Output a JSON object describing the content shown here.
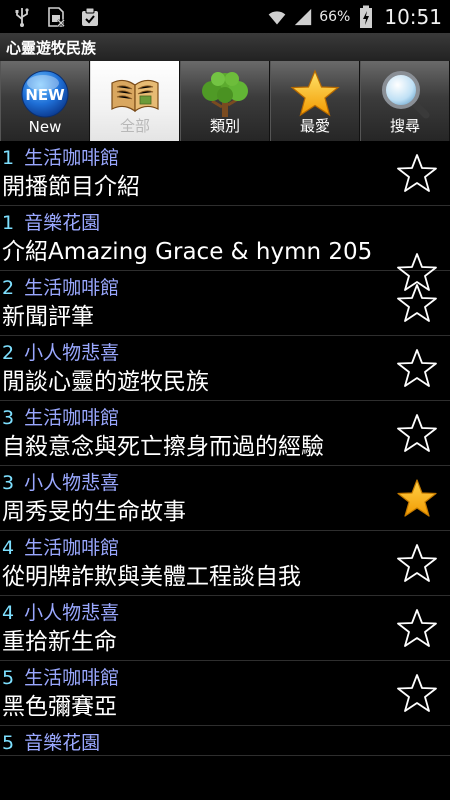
{
  "status_bar": {
    "left_icons": [
      "usb-icon",
      "sim-icon",
      "clipboard-check-icon"
    ],
    "battery_percent": "66%",
    "time": "10:51"
  },
  "app": {
    "title": "心靈遊牧民族"
  },
  "tabs": [
    {
      "label": "New",
      "icon": "new-badge-icon",
      "active": false
    },
    {
      "label": "全部",
      "icon": "open-book-icon",
      "active": true
    },
    {
      "label": "類別",
      "icon": "tree-icon",
      "active": false
    },
    {
      "label": "最愛",
      "icon": "star-icon",
      "active": false
    },
    {
      "label": "搜尋",
      "icon": "magnifier-icon",
      "active": false
    }
  ],
  "colors": {
    "number": "#7ee0ff",
    "category": "#9aa8ff",
    "star_filled": "#f5a800"
  },
  "episodes": [
    {
      "num": "1",
      "category": "生活咖啡館",
      "title": "開播節目介紹",
      "favorite": false
    },
    {
      "num": "1",
      "category": "音樂花園",
      "title": "介紹Amazing Grace & hymn 205",
      "favorite": false
    },
    {
      "num": "2",
      "category": "生活咖啡館",
      "title": "新聞評筆",
      "favorite": false
    },
    {
      "num": "2",
      "category": "小人物悲喜",
      "title": "閒談心靈的遊牧民族",
      "favorite": false
    },
    {
      "num": "3",
      "category": "生活咖啡館",
      "title": "自殺意念與死亡擦身而過的經驗",
      "favorite": false
    },
    {
      "num": "3",
      "category": "小人物悲喜",
      "title": "周秀旻的生命故事",
      "favorite": true
    },
    {
      "num": "4",
      "category": "生活咖啡館",
      "title": "從明牌詐欺與美體工程談自我",
      "favorite": false
    },
    {
      "num": "4",
      "category": "小人物悲喜",
      "title": "重拾新生命",
      "favorite": false
    },
    {
      "num": "5",
      "category": "生活咖啡館",
      "title": "黑色彌賽亞",
      "favorite": false
    },
    {
      "num": "5",
      "category": "音樂花園",
      "title": "",
      "favorite": false
    }
  ]
}
